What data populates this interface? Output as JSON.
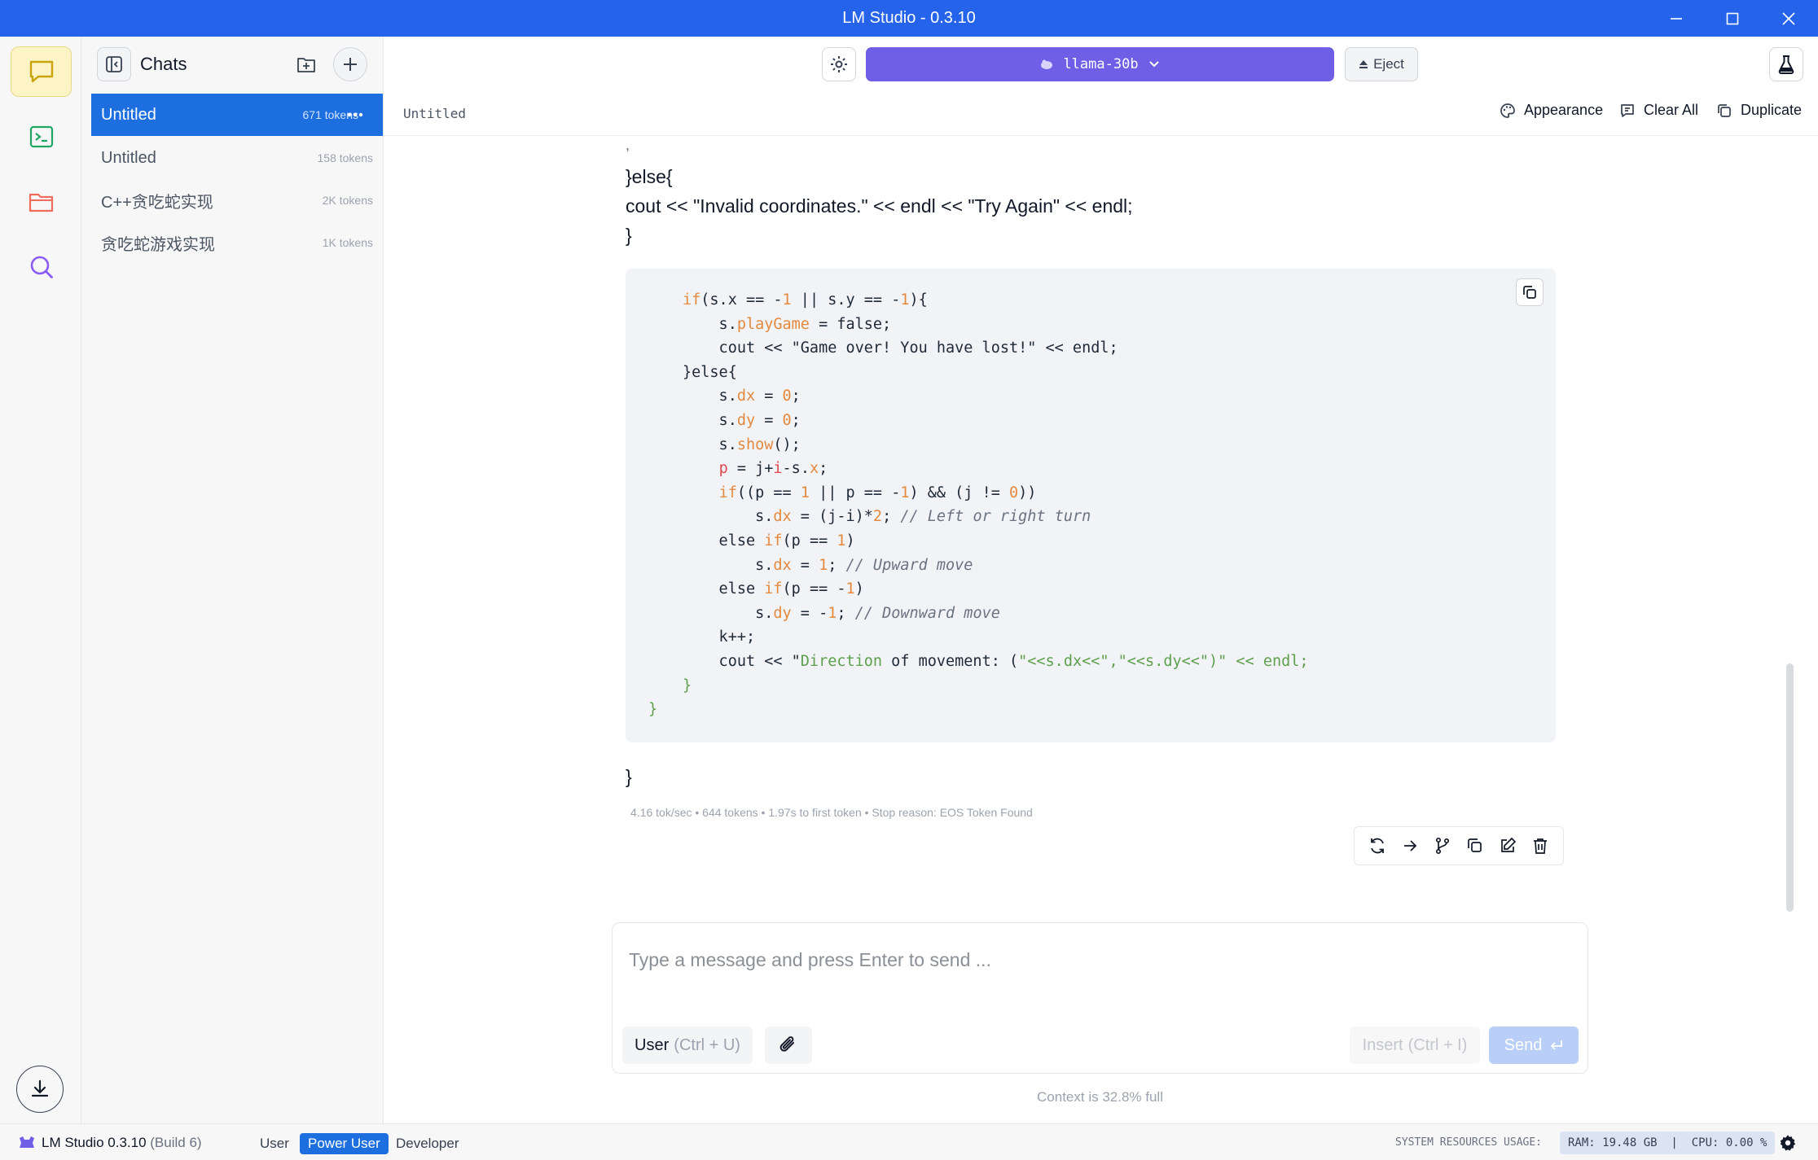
{
  "window": {
    "title": "LM Studio - 0.3.10"
  },
  "chats_panel": {
    "title": "Chats",
    "items": [
      {
        "name": "Untitled",
        "tokens": "671 tokens"
      },
      {
        "name": "Untitled",
        "tokens": "158 tokens"
      },
      {
        "name": "C++贪吃蛇实现",
        "tokens": "2K tokens"
      },
      {
        "name": "贪吃蛇游戏实现",
        "tokens": "1K tokens"
      }
    ]
  },
  "topbar": {
    "model": "llama-30b",
    "eject_label": "Eject"
  },
  "chat_header": {
    "title": "Untitled",
    "appearance_label": "Appearance",
    "clear_all_label": "Clear All",
    "duplicate_label": "Duplicate"
  },
  "message": {
    "prose_lines": [
      ",",
      "}else{",
      "cout << \"Invalid coordinates.\" << endl << \"Try Again\" << endl;",
      "}"
    ],
    "closing_brace": "}",
    "stats": "4.16 tok/sec  •  644 tokens  •  1.97s to first token  •  Stop reason: EOS Token Found"
  },
  "composer": {
    "placeholder": "Type a message and press Enter to send ...",
    "role_label": "User",
    "role_hint": "(Ctrl + U)",
    "insert_label": "Insert",
    "insert_hint": "(Ctrl + I)",
    "send_label": "Send"
  },
  "context_usage": "Context is 32.8% full",
  "status_bar": {
    "app_label": "LM Studio 0.3.10",
    "build": "(Build 6)",
    "modes": [
      "User",
      "Power User",
      "Developer"
    ],
    "active_mode": "Power User",
    "resources_label": "SYSTEM RESOURCES USAGE:",
    "resources_value": "RAM: 19.48 GB  |  CPU: 0.00 %"
  },
  "colors": {
    "accent": "#1d6fe0",
    "model_button": "#6f5ee6",
    "titlebar": "#2563eb"
  }
}
